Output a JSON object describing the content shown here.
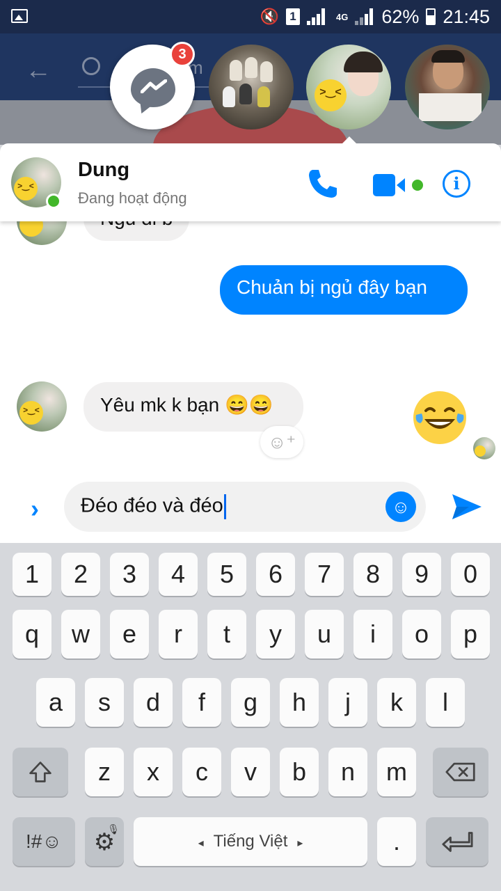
{
  "status_bar": {
    "battery": "62%",
    "time": "21:45",
    "sim": "1",
    "network": "4G"
  },
  "background_app": {
    "search_fragment": "m"
  },
  "chat_heads": {
    "unread_count": "3"
  },
  "chat": {
    "contact_name": "Dung",
    "contact_status": "Đang hoạt động",
    "messages": [
      {
        "from": "contact",
        "text": "Ngủ đi b"
      },
      {
        "from": "me",
        "text": "Chuản bị ngủ đây bạn"
      },
      {
        "from": "me",
        "type": "emoji",
        "text": "😂"
      },
      {
        "from": "contact",
        "text": "Yêu mk k bạn 😄😄"
      }
    ],
    "composer_text": "Đéo đéo và đéo"
  },
  "keyboard": {
    "numbers": [
      "1",
      "2",
      "3",
      "4",
      "5",
      "6",
      "7",
      "8",
      "9",
      "0"
    ],
    "row1": [
      "q",
      "w",
      "e",
      "r",
      "t",
      "y",
      "u",
      "i",
      "o",
      "p"
    ],
    "row2": [
      "a",
      "s",
      "d",
      "f",
      "g",
      "h",
      "j",
      "k",
      "l"
    ],
    "row3": [
      "z",
      "x",
      "c",
      "v",
      "b",
      "n",
      "m"
    ],
    "symbols_label": "!#☺",
    "space_label": "Tiếng Việt",
    "period_label": "."
  },
  "colors": {
    "accent": "#0084ff",
    "online": "#42b72a",
    "badge": "#e9413b"
  }
}
